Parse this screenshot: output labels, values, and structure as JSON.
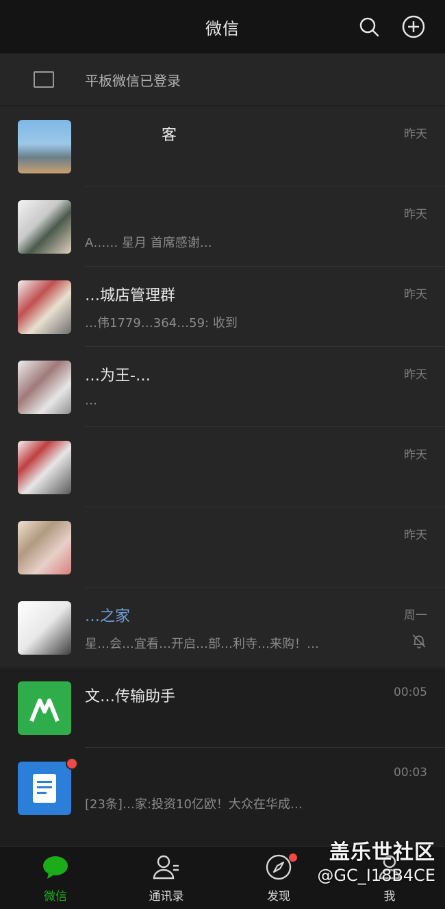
{
  "header": {
    "title": "微信",
    "search_icon": "search-icon",
    "add_icon": "plus-circle-icon"
  },
  "banner": {
    "text": "平板微信已登录",
    "icon": "tablet-icon"
  },
  "chats": [
    {
      "name": "客",
      "preview": "",
      "time": "昨天",
      "avatar_color": "#6aa6d8"
    },
    {
      "name": "",
      "preview": "A…… 星月  首席感谢…",
      "time": "昨天",
      "avatar_color": "#8f8f8f"
    },
    {
      "name": "…城店管理群",
      "preview": "…伟1779…364…59: 收到",
      "time": "昨天",
      "avatar_color": "#b07070"
    },
    {
      "name": "…为王-…",
      "preview": "…",
      "time": "昨天",
      "avatar_color": "#a08080"
    },
    {
      "name": "",
      "preview": "",
      "time": "昨天",
      "avatar_color": "#c04040"
    },
    {
      "name": "",
      "preview": "",
      "time": "昨天",
      "avatar_color": "#b09a80"
    },
    {
      "name": "…之家",
      "preview": "星…会…宜看…开启…部…利寺…来购！…",
      "time": "周一",
      "avatar_color": "#e8e8e8"
    },
    {
      "name": "文…传输助手",
      "preview": "",
      "time": "00:05",
      "avatar_color": "#2fad4a"
    },
    {
      "name": "",
      "preview": "[23条]…家:投资10亿欧！大众在华成…",
      "time": "00:03",
      "avatar_color": "#2b7fd8"
    }
  ],
  "tabs": [
    {
      "label": "微信",
      "icon": "chat-bubble-icon"
    },
    {
      "label": "通讯录",
      "icon": "contacts-icon"
    },
    {
      "label": "发现",
      "icon": "compass-icon"
    },
    {
      "label": "我",
      "icon": "person-icon"
    }
  ],
  "watermark": {
    "line1": "盖乐世社区",
    "line2": "@GC_I18B4CE"
  },
  "colors": {
    "accent": "#1aad19",
    "badge": "#f24848"
  }
}
